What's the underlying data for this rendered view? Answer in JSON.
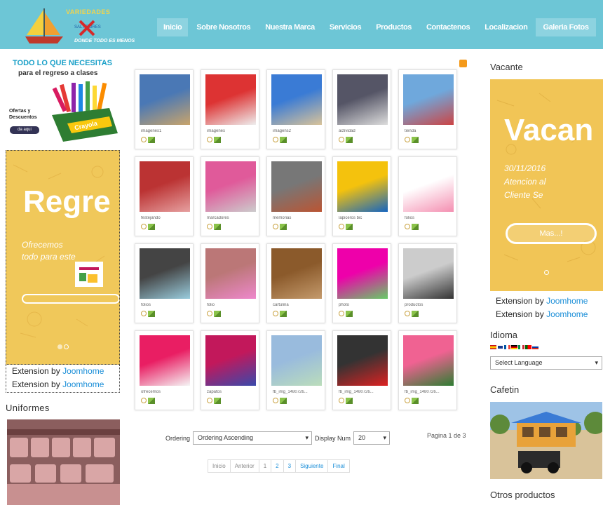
{
  "header": {
    "logo": {
      "line1": "VARIEDADES",
      "line2": "SAL   ADORES",
      "line3": "DONDE TODO ES MENOS"
    },
    "nav": [
      {
        "label": "Inicio",
        "active": true
      },
      {
        "label": "Sobre Nosotros"
      },
      {
        "label": "Nuestra Marca"
      },
      {
        "label": "Servicios"
      },
      {
        "label": "Productos"
      },
      {
        "label": "Contactenos"
      },
      {
        "label": "Localizacion"
      },
      {
        "label": "Galeria Fotos"
      }
    ]
  },
  "left": {
    "ad": {
      "headline": "TODO LO QUE NECESITAS",
      "sub": "para el regreso a clases",
      "offers": "Ofertas y Descuentos",
      "button": "da aqui",
      "brand": "Crayola"
    },
    "slider": {
      "title": "Regre",
      "text": "Ofrecemos todo para este"
    },
    "extensions": [
      {
        "prefix": "Extension by",
        "link": "Joomhome"
      },
      {
        "prefix": "Extension by",
        "link": "Joomhome"
      }
    ],
    "uniformes_title": "Uniformes"
  },
  "gallery": {
    "items": [
      {
        "caption": "imagenes1"
      },
      {
        "caption": "imagenes"
      },
      {
        "caption": "imagens2"
      },
      {
        "caption": "actividad"
      },
      {
        "caption": "tienda"
      },
      {
        "caption": "festejando"
      },
      {
        "caption": "marcadores"
      },
      {
        "caption": "memorias"
      },
      {
        "caption": "lapiceros bic"
      },
      {
        "caption": "folios"
      },
      {
        "caption": "folios"
      },
      {
        "caption": "folio"
      },
      {
        "caption": "cartulina"
      },
      {
        "caption": "photo"
      },
      {
        "caption": "productos"
      },
      {
        "caption": "ofrecemos"
      },
      {
        "caption": "zapatos"
      },
      {
        "caption": "fb_img_1480726..."
      },
      {
        "caption": "fb_img_1480726..."
      },
      {
        "caption": "fb_img_1480726..."
      }
    ],
    "ordering_label": "Ordering",
    "ordering_value": "Ordering Ascending",
    "display_label": "Display Num",
    "display_value": "20",
    "page_info": "Pagina 1 de 3",
    "pager": [
      "Inicio",
      "Anterior",
      "1",
      "2",
      "3",
      "Siguiente",
      "Final"
    ]
  },
  "right": {
    "vacante_title": "Vacante",
    "slider": {
      "title": "Vacan",
      "text": "30/11/2016 Atencion al Cliente Se",
      "button": "Mas...!"
    },
    "extensions": [
      {
        "prefix": "Extension by",
        "link": "Joomhome"
      },
      {
        "prefix": "Extension by",
        "link": "Joomhome"
      }
    ],
    "idioma_title": "Idioma",
    "language_select": "Select Language",
    "cafetin_title": "Cafetin",
    "otros_title": "Otros productos"
  },
  "colors": {
    "header": "#6dc6d6",
    "slider": "#f1c556",
    "link": "#1c8fd8"
  }
}
